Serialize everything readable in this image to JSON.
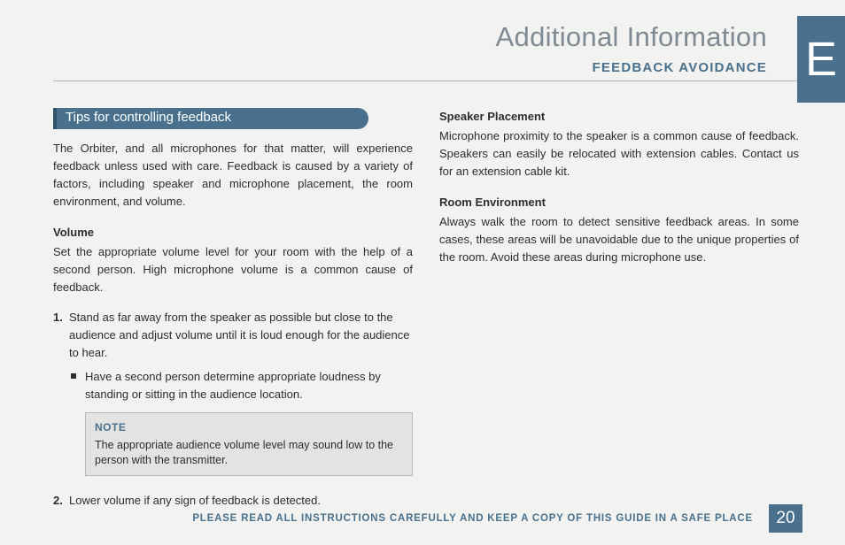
{
  "page": {
    "section_letter": "E",
    "title": "Additional Information",
    "subtitle": "FEEDBACK AVOIDANCE",
    "footer": "PLEASE READ ALL INSTRUCTIONS CAREFULLY AND KEEP A COPY OF THIS GUIDE IN A SAFE PLACE",
    "page_number": "20"
  },
  "tips": {
    "heading": "Tips for controlling feedback",
    "intro": "The Orbiter, and all microphones for that matter, will experience feedback unless used with care. Feedback is caused by a variety of factors, including speaker and microphone placement, the room environment, and volume.",
    "volume_heading": "Volume",
    "volume_intro": "Set the appropriate volume level for your room with the help of a second person. High microphone volume is a common cause of feedback.",
    "step1": "Stand as far away from the speaker as possible but close to the audience and adjust volume until it is loud enough for the audience to hear.",
    "step1_bullet": "Have a second person determine appropriate loudness by standing or sitting in the audience location.",
    "note_label": "NOTE",
    "note_body": "The appropriate audience volume level may sound low to the person with the transmitter.",
    "step2": "Lower volume if any sign of feedback is detected.",
    "speaker_heading": "Speaker Placement",
    "speaker_body": "Microphone proximity to the speaker is a common cause of feedback. Speakers can easily be relocated with extension cables. Contact us for an extension cable kit.",
    "room_heading": "Room Environment",
    "room_body": "Always walk the room to detect sensitive feedback areas. In some cases, these areas will be unavoidable due to the unique properties of the room. Avoid these areas during microphone use."
  }
}
